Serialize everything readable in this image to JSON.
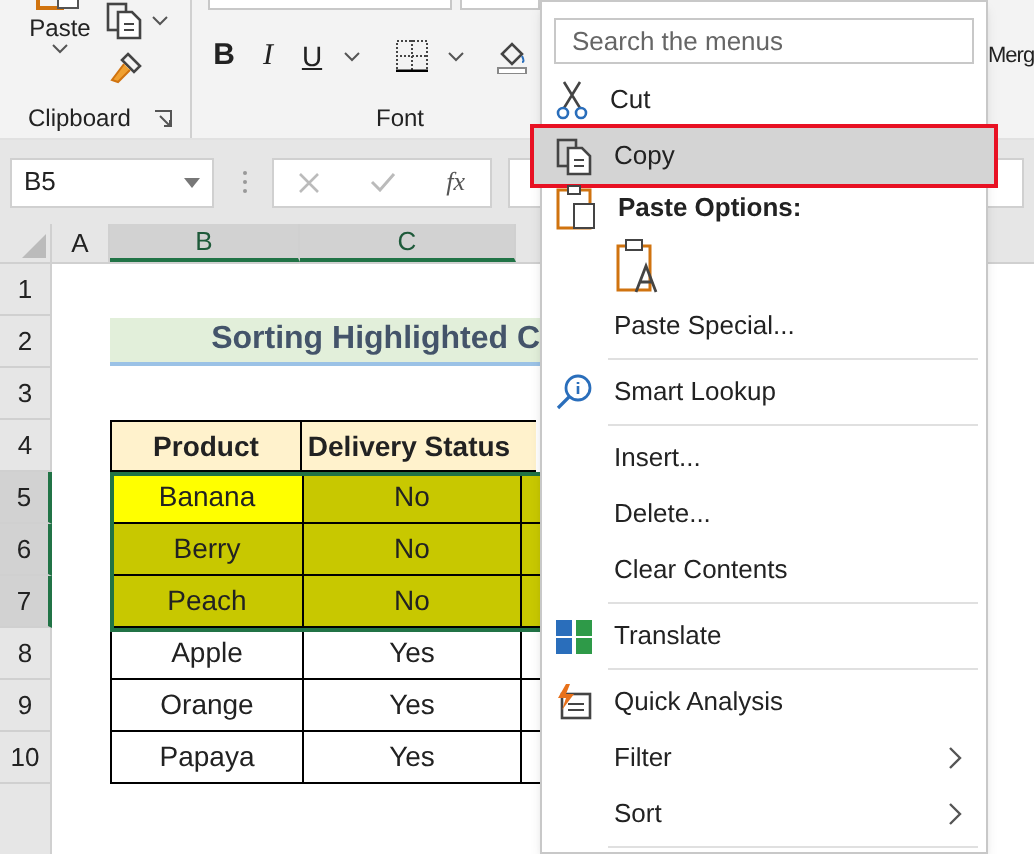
{
  "ribbon": {
    "clipboard": {
      "paste_label": "Paste",
      "group_label": "Clipboard"
    },
    "font": {
      "bold": "B",
      "italic": "I",
      "underline": "U",
      "group_label": "Font"
    },
    "merge_label": "Merg"
  },
  "formula_bar": {
    "name_box": "B5",
    "fx": "fx"
  },
  "columns": [
    {
      "label": "A",
      "selected": false
    },
    {
      "label": "B",
      "selected": true
    },
    {
      "label": "C",
      "selected": true
    }
  ],
  "title": "Sorting Highlighted C",
  "table": {
    "columns": [
      "Product",
      "Delivery Status"
    ],
    "rows": [
      {
        "number": "5",
        "selected": true,
        "product": {
          "text": "Banana",
          "color": "#ffff00"
        },
        "status": {
          "text": "No",
          "color": "#c8c800"
        }
      },
      {
        "number": "6",
        "selected": true,
        "product": {
          "text": "Berry",
          "color": "#c8c800"
        },
        "status": {
          "text": "No",
          "color": "#c8c800"
        }
      },
      {
        "number": "7",
        "selected": true,
        "product": {
          "text": "Peach",
          "color": "#c8c800"
        },
        "status": {
          "text": "No",
          "color": "#c8c800"
        }
      },
      {
        "number": "8",
        "selected": false,
        "product": {
          "text": "Apple"
        },
        "status": {
          "text": "Yes"
        }
      },
      {
        "number": "9",
        "selected": false,
        "product": {
          "text": "Orange"
        },
        "status": {
          "text": "Yes"
        }
      },
      {
        "number": "10",
        "selected": false,
        "product": {
          "text": "Papaya"
        },
        "status": {
          "text": "Yes"
        }
      }
    ]
  },
  "row_numbers": [
    "1",
    "2",
    "3",
    "4"
  ],
  "context_menu": {
    "search": {
      "placeholder": "Search the menus"
    },
    "items": [
      {
        "kind": "item",
        "label": "Cut",
        "selected": false
      },
      {
        "kind": "item",
        "label": "Copy",
        "selected": true
      },
      {
        "kind": "header",
        "label": "Paste Options:"
      },
      {
        "kind": "paste_option"
      },
      {
        "kind": "item",
        "label": "Paste Special...",
        "selected": false
      },
      {
        "kind": "separator"
      },
      {
        "kind": "item",
        "label": "Smart Lookup",
        "selected": false
      },
      {
        "kind": "separator"
      },
      {
        "kind": "item",
        "label": "Insert...",
        "selected": false
      },
      {
        "kind": "item",
        "label": "Delete...",
        "selected": false
      },
      {
        "kind": "item",
        "label": "Clear Contents",
        "selected": false
      },
      {
        "kind": "separator"
      },
      {
        "kind": "item",
        "label": "Translate",
        "selected": false
      },
      {
        "kind": "separator"
      },
      {
        "kind": "item",
        "label": "Quick Analysis",
        "selected": false
      },
      {
        "kind": "submenu",
        "label": "Filter",
        "selected": false
      },
      {
        "kind": "submenu",
        "label": "Sort",
        "selected": false
      },
      {
        "kind": "separator"
      }
    ]
  }
}
